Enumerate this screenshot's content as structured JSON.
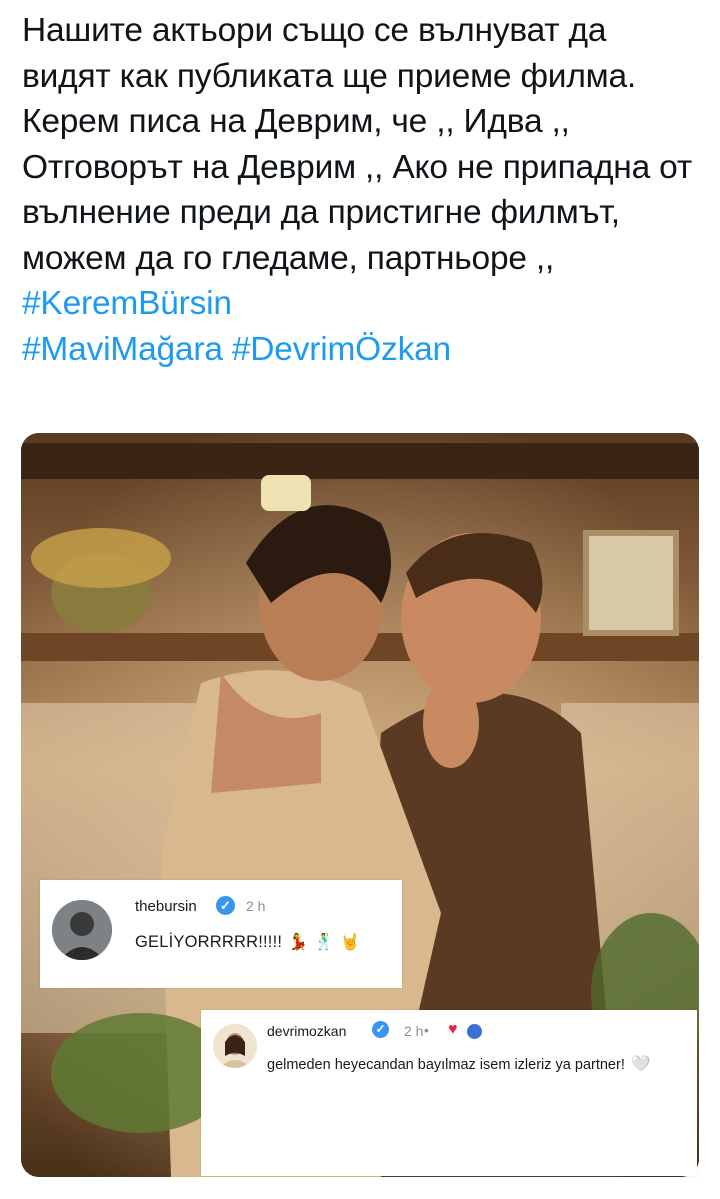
{
  "tweet": {
    "text": "Нашите актьори също се вълнуват да видят как публиката ще приеме филма. Керем писа на Деврим, че ,, Идва ,, Отговорът на Деврим ,, Ако не припадна от вълнение преди да пристигне филмът, можем да го гледаме, партньоре ,,",
    "hashtags": [
      "#KeremBürsin",
      "#MaviMağara",
      "#DevrimÖzkan"
    ]
  },
  "comments": [
    {
      "username": "thebursin",
      "time": "2 h",
      "text": "GELİYORRRRR!!!!!",
      "emojis": [
        "dancing-woman-emoji",
        "dancing-man-emoji",
        "rock-hand-emoji"
      ]
    },
    {
      "username": "devrimozkan",
      "time": "2 h",
      "separator": "•",
      "text": "gelmeden heyecandan bayılmaz isem izleriz ya partner!",
      "emojis": [
        "white-heart-emoji"
      ]
    }
  ],
  "colors": {
    "text": "#0f1419",
    "hashtag": "#1d9bf0",
    "verified": "#3797f0",
    "liked_heart": "#ed1c47"
  }
}
